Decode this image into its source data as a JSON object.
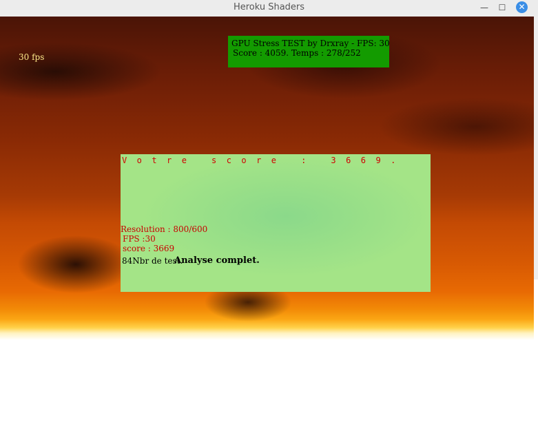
{
  "window": {
    "title": "Heroku Shaders",
    "minimize_glyph": "—",
    "maximize_glyph": "☐",
    "close_glyph": "✕"
  },
  "overlay": {
    "fps": "30 fps"
  },
  "stress_box": {
    "line1": "GPU Stress TEST by Drxray  - FPS: 30",
    "line2": "Score : 4059. Temps : 278/252"
  },
  "score_panel": {
    "heading": "V  o  t  r  e     s  c  o  r  e     :     3  6  6  9  .",
    "resolution": "Resolution : 800/600",
    "fps": "FPS :30",
    "score": "score : 3669",
    "tests": "84Nbr de test.",
    "status": "Analyse complet."
  },
  "colors": {
    "stress_box_bg": "#139b00",
    "panel_text": "#c80000",
    "close_button": "#3a8ee6"
  }
}
